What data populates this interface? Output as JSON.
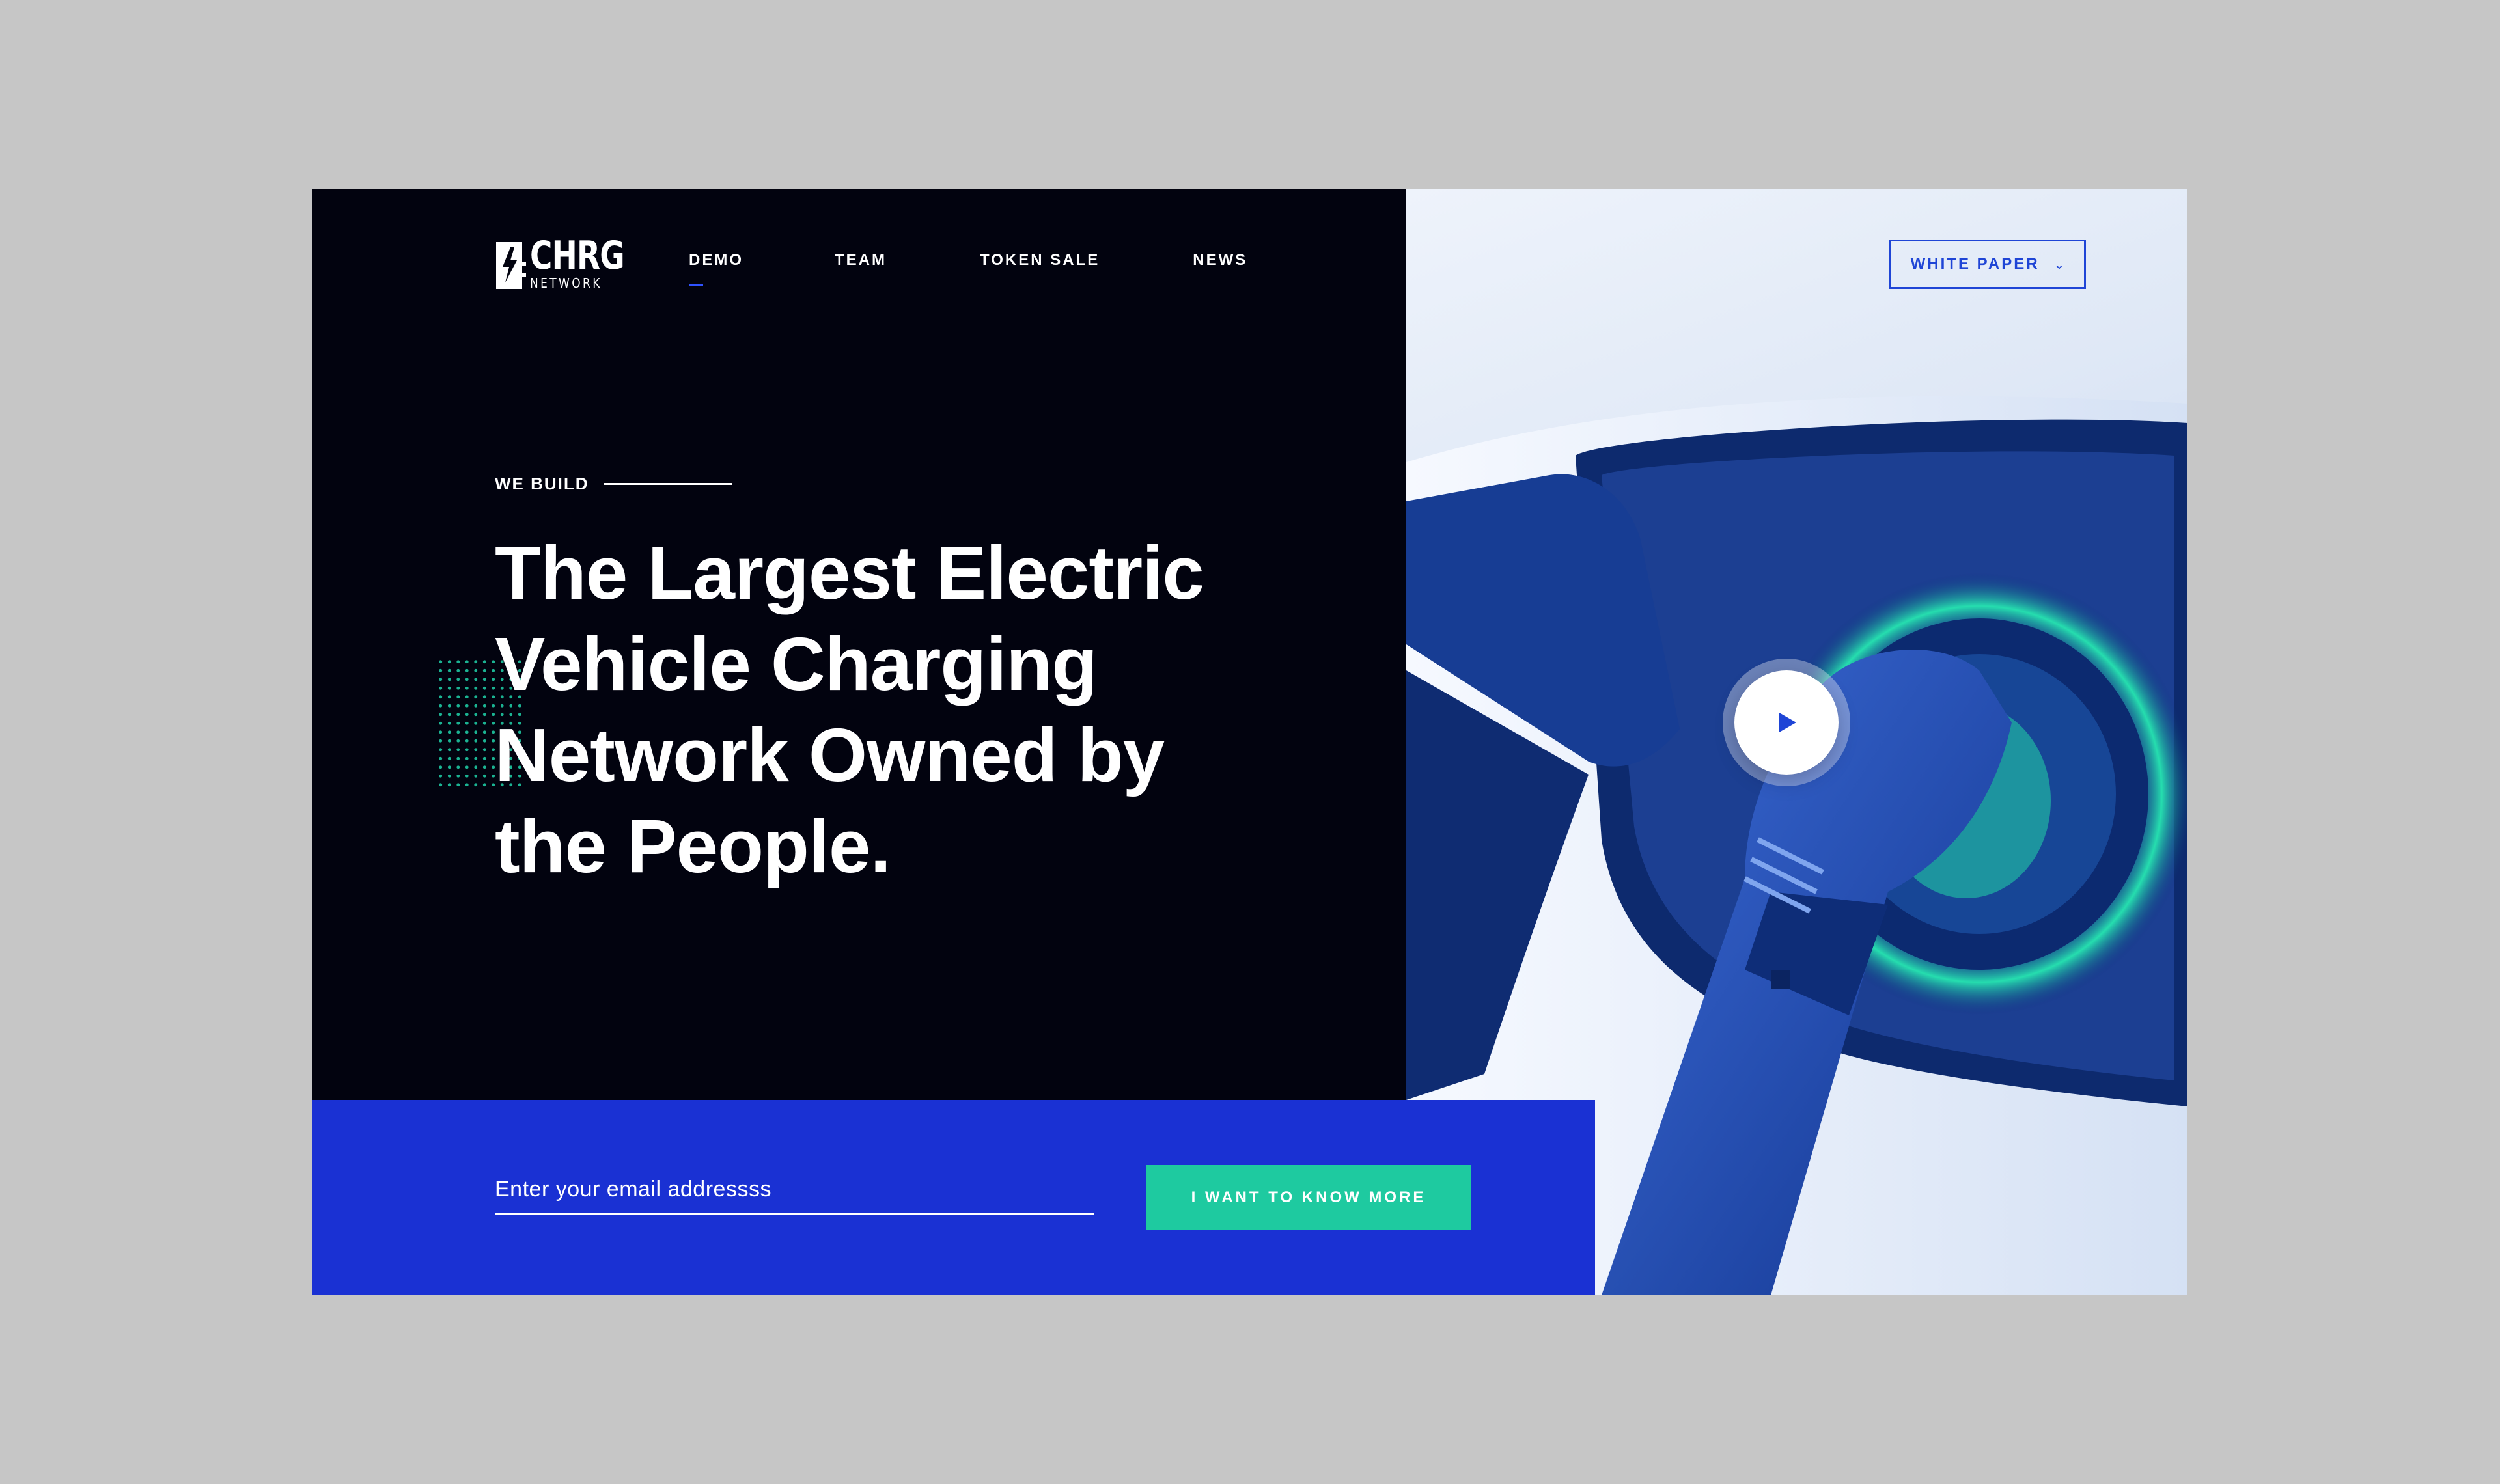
{
  "brand": {
    "name": "CHRG",
    "sub": "NETWORK"
  },
  "nav": {
    "items": [
      {
        "label": "DEMO",
        "active": true
      },
      {
        "label": "TEAM",
        "active": false
      },
      {
        "label": "TOKEN SALE",
        "active": false
      },
      {
        "label": "NEWS",
        "active": false
      }
    ]
  },
  "hero": {
    "kicker": "WE BUILD",
    "headline_lines": [
      "The Largest Electric",
      "Vehicle Charging",
      "Network Owned by",
      "the People."
    ]
  },
  "whitepaper": {
    "label": "WHITE PAPER",
    "chevron_icon": "chevron-down-icon"
  },
  "video": {
    "icon": "play-icon"
  },
  "signup": {
    "placeholder": "Enter your email addressss",
    "button_label": "I WANT TO KNOW MORE"
  },
  "colors": {
    "dark": "#02030f",
    "accent_blue": "#1a31d3",
    "link_blue": "#1f45d6",
    "teal": "#1ecaa0",
    "nav_underline": "#2f52ff",
    "page_bg": "#c6c6c6"
  }
}
